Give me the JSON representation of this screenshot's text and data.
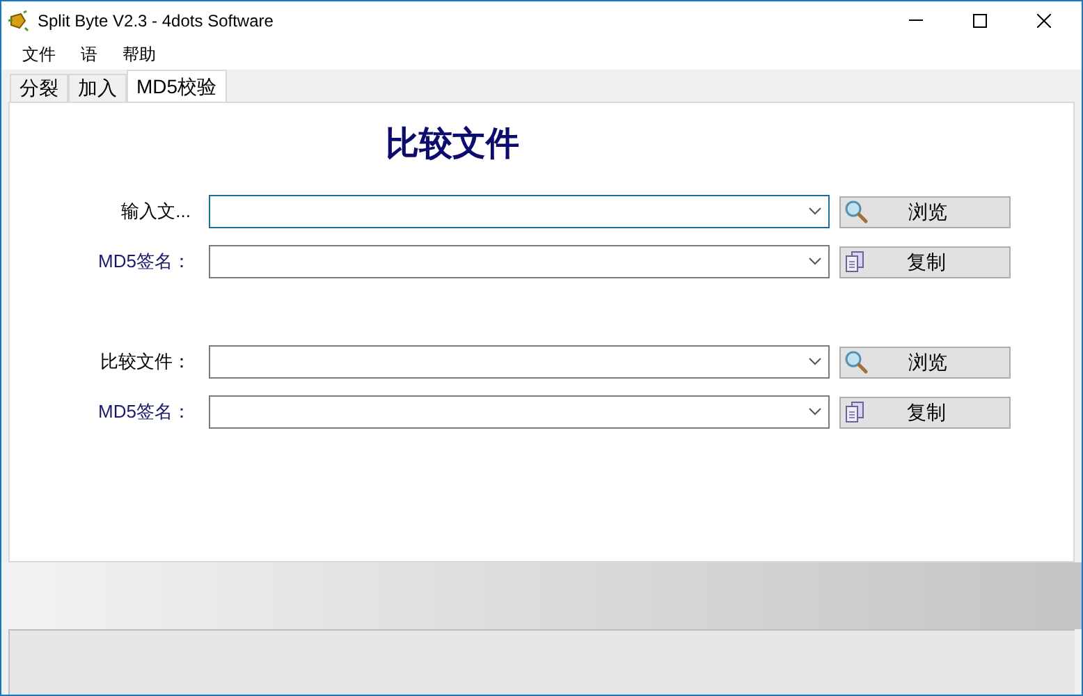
{
  "window": {
    "title": "Split Byte V2.3 - 4dots Software"
  },
  "menu": [
    "文件",
    "语",
    "帮助"
  ],
  "tabs": [
    {
      "label": "分裂",
      "selected": false
    },
    {
      "label": "加入",
      "selected": false
    },
    {
      "label": "MD5校验",
      "selected": true
    }
  ],
  "heading": "比较文件",
  "sections": [
    {
      "rows": [
        {
          "kind": "file",
          "label": "输入文...",
          "focused": true,
          "button": "浏览"
        },
        {
          "kind": "signature",
          "label": "MD5签名：",
          "focused": false,
          "button": "复制"
        }
      ]
    },
    {
      "rows": [
        {
          "kind": "file",
          "label": "比较文件：",
          "focused": false,
          "button": "浏览"
        },
        {
          "kind": "signature",
          "label": "MD5签名：",
          "focused": false,
          "button": "复制"
        }
      ]
    }
  ]
}
